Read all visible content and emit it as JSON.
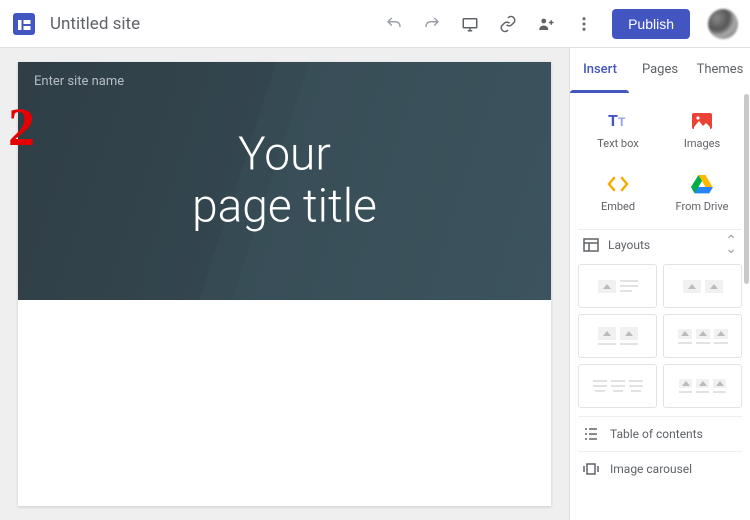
{
  "topbar": {
    "site_title": "Untitled site",
    "publish_label": "Publish"
  },
  "tutorial": {
    "step_number": "2"
  },
  "canvas": {
    "site_name_placeholder": "Enter site name",
    "page_title": "Your\npage title"
  },
  "sidepanel": {
    "tabs": {
      "insert": "Insert",
      "pages": "Pages",
      "themes": "Themes",
      "active": "insert"
    },
    "insert_items": {
      "textbox": "Text box",
      "images": "Images",
      "embed": "Embed",
      "drive": "From Drive"
    },
    "layouts_label": "Layouts",
    "table_of_contents": "Table of contents",
    "image_carousel": "Image carousel"
  },
  "colors": {
    "accent": "#4355c0",
    "hero_bg": "#364a54"
  }
}
